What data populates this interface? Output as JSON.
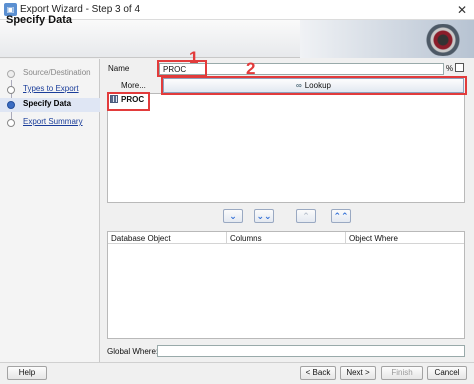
{
  "window": {
    "title": "Export Wizard - Step 3 of 4"
  },
  "header": {
    "title": "Specify Data"
  },
  "steps": [
    {
      "label": "Source/Destination",
      "state": "disabled"
    },
    {
      "label": "Types to Export",
      "state": "link"
    },
    {
      "label": "Specify Data",
      "state": "active"
    },
    {
      "label": "Export Summary",
      "state": "link"
    }
  ],
  "form": {
    "name_label": "Name",
    "name_value": "PROC",
    "percent_label": "%",
    "more_label": "More...",
    "lookup_label": "Lookup",
    "lookup_icon": "binoculars-icon",
    "global_where_label": "Global Where:"
  },
  "tree": {
    "items": [
      {
        "label": "PROC",
        "icon": "procedure-icon"
      }
    ]
  },
  "move_buttons": {
    "move_down": "⌄",
    "move_all_down": "⌄⌄",
    "move_up": "⌃",
    "move_all_up": "⌃⌃"
  },
  "grid": {
    "columns": [
      "Database Object",
      "Columns",
      "Object Where"
    ]
  },
  "footer": {
    "help": "Help",
    "back": "< Back",
    "next": "Next >",
    "finish": "Finish",
    "cancel": "Cancel"
  },
  "annotations": {
    "box1_number": "1",
    "box2_number": "2"
  },
  "colors": {
    "annotation": "#e23b3b",
    "link": "#1a3d9a",
    "accent": "#2b6bd6"
  }
}
